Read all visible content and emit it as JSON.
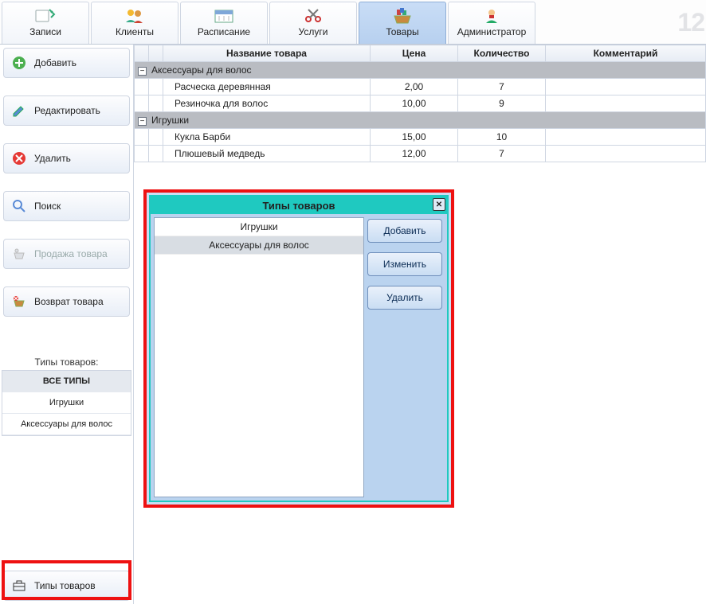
{
  "brand": "12",
  "toolbar": {
    "items": [
      {
        "id": "records",
        "label": "Записи"
      },
      {
        "id": "clients",
        "label": "Клиенты"
      },
      {
        "id": "schedule",
        "label": "Расписание"
      },
      {
        "id": "services",
        "label": "Услуги"
      },
      {
        "id": "goods",
        "label": "Товары",
        "active": true
      },
      {
        "id": "admin",
        "label": "Администратор"
      }
    ]
  },
  "sidebar": {
    "add": "Добавить",
    "edit": "Редактировать",
    "delete": "Удалить",
    "search": "Поиск",
    "sell": "Продажа товара",
    "return": "Возврат товара",
    "types_title": "Типы товаров:",
    "types_all": "ВСЕ ТИПЫ",
    "types": [
      "Игрушки",
      "Аксессуары для волос"
    ],
    "bottom": "Типы товаров"
  },
  "table": {
    "headers": {
      "name": "Название товара",
      "price": "Цена",
      "qty": "Количество",
      "comment": "Комментарий"
    },
    "groups": [
      {
        "name": "Аксессуары для волос",
        "rows": [
          {
            "name": "Расческа деревянная",
            "price": "2,00",
            "qty": "7",
            "comment": ""
          },
          {
            "name": "Резиночка для волос",
            "price": "10,00",
            "qty": "9",
            "comment": ""
          }
        ]
      },
      {
        "name": "Игрушки",
        "rows": [
          {
            "name": "Кукла Барби",
            "price": "15,00",
            "qty": "10",
            "comment": ""
          },
          {
            "name": "Плюшевый медведь",
            "price": "12,00",
            "qty": "7",
            "comment": ""
          }
        ]
      }
    ]
  },
  "dialog": {
    "title": "Типы товаров",
    "items": [
      "Игрушки",
      "Аксессуары для волос"
    ],
    "selected_index": 1,
    "btn_add": "Добавить",
    "btn_edit": "Изменить",
    "btn_delete": "Удалить"
  }
}
